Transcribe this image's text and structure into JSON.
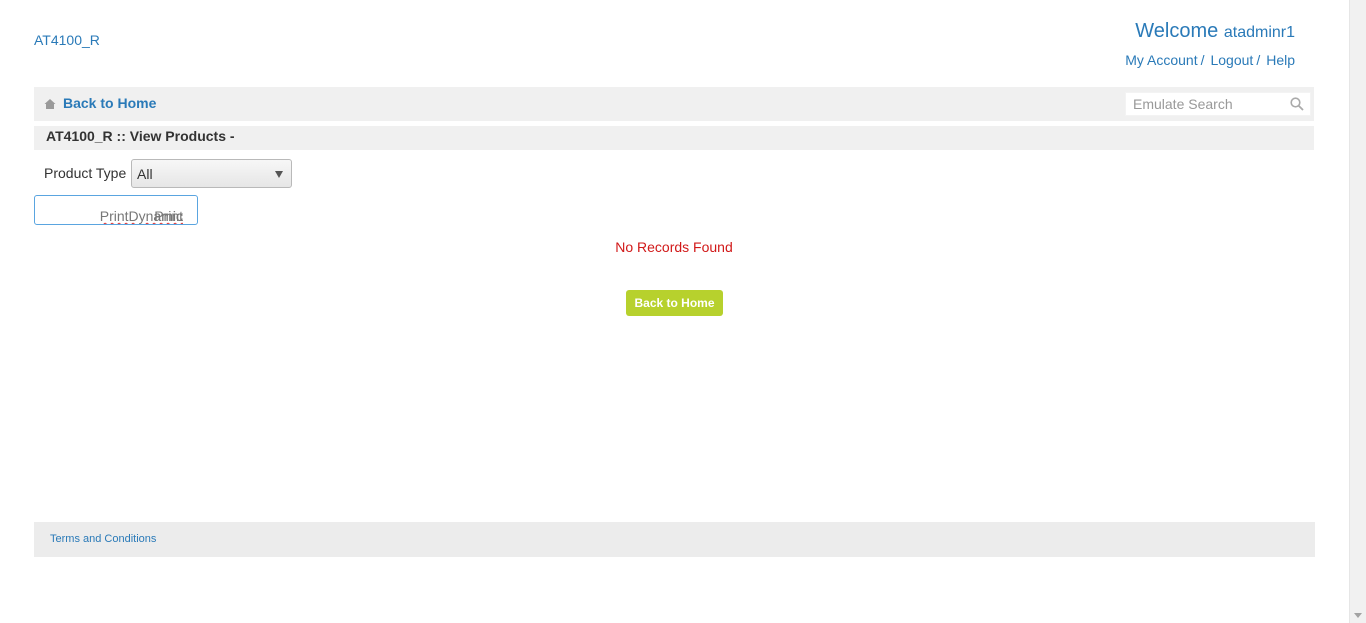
{
  "header": {
    "brand": "AT4100_R",
    "welcome_label": "Welcome",
    "username": "atadminr1",
    "links": {
      "my_account": "My Account",
      "logout": "Logout",
      "help": "Help",
      "separator": "/"
    }
  },
  "navbar": {
    "home_icon": "home-icon",
    "back_home": "Back to Home",
    "search_placeholder": "Emulate Search",
    "search_icon": "search-icon"
  },
  "page": {
    "title": "AT4100_R :: View Products -"
  },
  "filter": {
    "label": "Product Type :",
    "selected": "All"
  },
  "text_input": {
    "visible_value_prefix": "amic ",
    "visible_value_word": "PrintDynamic",
    "visible_value_suffix": " Print"
  },
  "results": {
    "message": "No Records Found",
    "button": "Back to Home"
  },
  "footer": {
    "terms": "Terms and Conditions"
  },
  "colors": {
    "link": "#2a7ab8",
    "error": "#d11919",
    "button": "#b7d12d",
    "bar": "#f0f0f0"
  }
}
